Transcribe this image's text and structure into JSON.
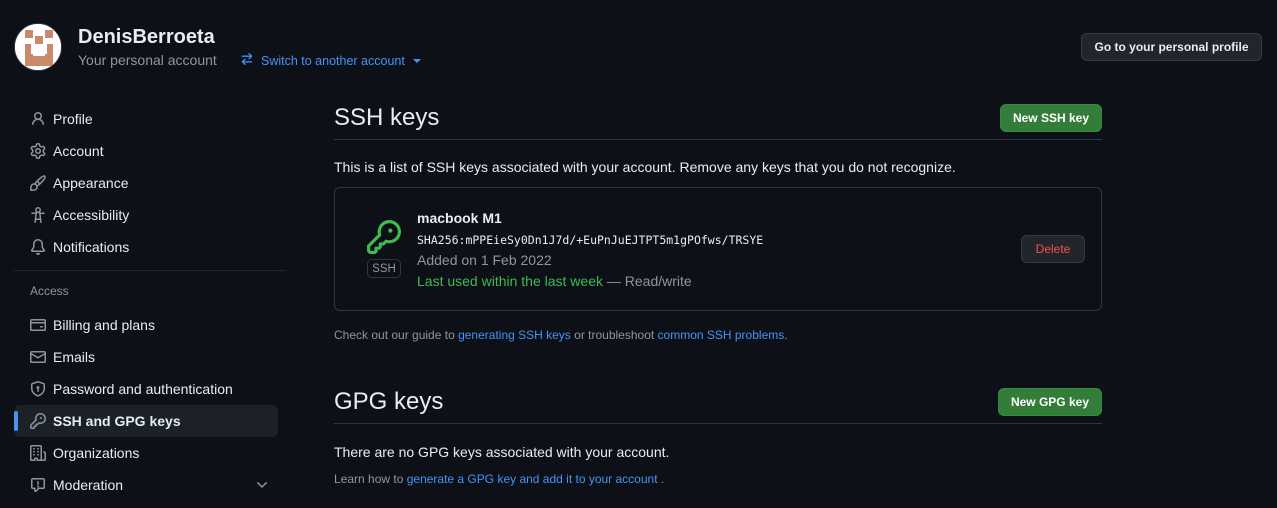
{
  "header": {
    "account_name": "DenisBerroeta",
    "account_subtitle": "Your personal account",
    "switch_account_label": "Switch to another account",
    "personal_profile_button": "Go to your personal profile"
  },
  "sidebar": {
    "items": [
      {
        "label": "Profile",
        "icon": "person-icon"
      },
      {
        "label": "Account",
        "icon": "gear-icon"
      },
      {
        "label": "Appearance",
        "icon": "paintbrush-icon"
      },
      {
        "label": "Accessibility",
        "icon": "accessibility-icon"
      },
      {
        "label": "Notifications",
        "icon": "bell-icon"
      }
    ],
    "access_heading": "Access",
    "access_items": [
      {
        "label": "Billing and plans",
        "icon": "credit-card-icon"
      },
      {
        "label": "Emails",
        "icon": "mail-icon"
      },
      {
        "label": "Password and authentication",
        "icon": "shield-icon"
      },
      {
        "label": "SSH and GPG keys",
        "icon": "key-icon",
        "active": true
      },
      {
        "label": "Organizations",
        "icon": "organization-icon"
      },
      {
        "label": "Moderation",
        "icon": "comment-icon"
      }
    ]
  },
  "ssh": {
    "title": "SSH keys",
    "new_button": "New SSH key",
    "description": "This is a list of SSH keys associated with your account. Remove any keys that you do not recognize.",
    "keys": [
      {
        "name": "macbook M1",
        "fingerprint": "SHA256:mPPEieSy0Dn1J7d/+EuPnJuEJTPT5m1gPOfws/TRSYE",
        "added": "Added on 1 Feb 2022",
        "last_used": "Last used within the last week",
        "access": " — Read/write",
        "badge": "SSH",
        "delete_label": "Delete"
      }
    ],
    "note_prefix": "Check out our guide to ",
    "note_link1": "generating SSH keys",
    "note_middle": " or troubleshoot ",
    "note_link2": "common SSH problems",
    "note_suffix": "."
  },
  "gpg": {
    "title": "GPG keys",
    "new_button": "New GPG key",
    "empty_text": "There are no GPG keys associated with your account.",
    "learn_prefix": "Learn how to ",
    "learn_link": "generate a GPG key and add it to your account",
    "learn_suffix": " ."
  },
  "colors": {
    "background": "#0d1117",
    "accent_link": "#4493f8",
    "primary_button": "#347d39",
    "danger": "#f85149",
    "success": "#3fb950"
  }
}
